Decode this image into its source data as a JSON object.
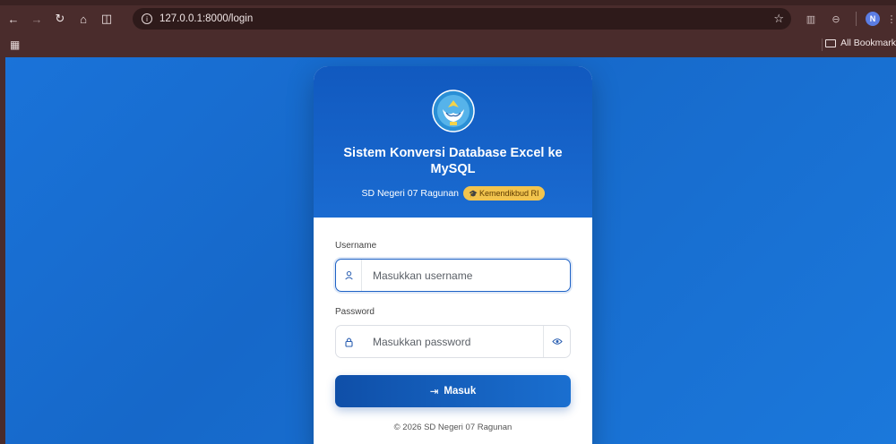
{
  "browser": {
    "url": "127.0.0.1:8000/login",
    "bookmarks_label": "All Bookmark",
    "profile_initial": "N"
  },
  "card": {
    "title": "Sistem Konversi Database Excel ke MySQL",
    "school": "SD Negeri 07 Ragunan",
    "badge": "Kemendikbud RI",
    "username_label": "Username",
    "username_placeholder": "Masukkan username",
    "password_label": "Password",
    "password_placeholder": "Masukkan password",
    "submit_label": "Masuk",
    "footer": "© 2026 SD Negeri 07 Ragunan"
  },
  "colors": {
    "accent": "#1a6bd1",
    "badge": "#f2c44e",
    "chrome": "#4a2c2c"
  }
}
